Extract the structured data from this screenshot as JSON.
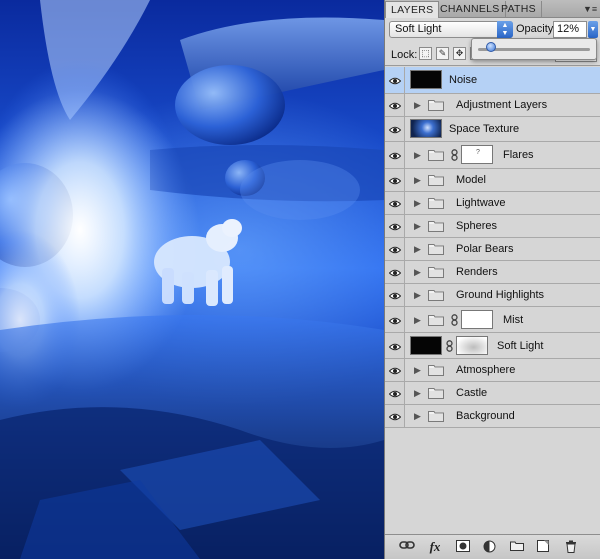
{
  "panel": {
    "tabs": [
      "LAYERS",
      "CHANNELS",
      "PATHS"
    ],
    "active_tab": "LAYERS",
    "menu_glyph": "▼≡"
  },
  "blend": {
    "mode": "Soft Light",
    "opacity_label": "Opacity:",
    "opacity_value": "12%",
    "opacity_fraction": 0.12
  },
  "lock": {
    "label": "Lock:"
  },
  "layers": [
    {
      "name": "Noise",
      "kind": "fill",
      "selected": true
    },
    {
      "name": "Adjustment Layers",
      "kind": "group"
    },
    {
      "name": "Space Texture",
      "kind": "image"
    },
    {
      "name": "Flares",
      "kind": "group-mask"
    },
    {
      "name": "Model",
      "kind": "group"
    },
    {
      "name": "Lightwave",
      "kind": "group"
    },
    {
      "name": "Spheres",
      "kind": "group"
    },
    {
      "name": "Polar Bears",
      "kind": "group"
    },
    {
      "name": "Renders",
      "kind": "group"
    },
    {
      "name": "Ground Highlights",
      "kind": "group"
    },
    {
      "name": "Mist",
      "kind": "group-mask"
    },
    {
      "name": "Soft Light",
      "kind": "fill-mask"
    },
    {
      "name": "Atmosphere",
      "kind": "group"
    },
    {
      "name": "Castle",
      "kind": "group"
    },
    {
      "name": "Background",
      "kind": "group"
    }
  ],
  "bottom_icons": [
    "link-icon",
    "fx-icon",
    "mask-icon",
    "adjustment-icon",
    "new-group-icon",
    "new-layer-icon",
    "trash-icon"
  ],
  "bottom_fx_label": "fx",
  "colors": {
    "panel_bg": "#d6d6d6",
    "selected_row": "#b5d1f5",
    "accent_blue": "#2a66c8"
  }
}
